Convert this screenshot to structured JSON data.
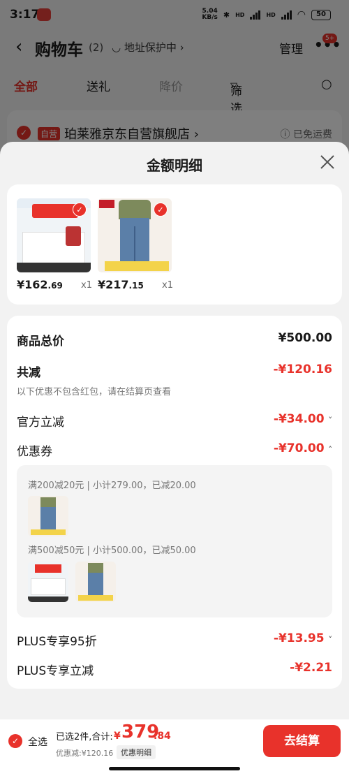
{
  "status": {
    "time": "3:17",
    "net_speed": "5.04",
    "net_unit": "KB/s",
    "sig1_label": "HD",
    "sig2_label": "HD",
    "battery": "50"
  },
  "nav": {
    "title": "购物车",
    "count": "(2)",
    "address": "地址保护中",
    "manage": "管理",
    "badge": "5+"
  },
  "tabs": [
    {
      "label": "全部"
    },
    {
      "label": "送礼"
    },
    {
      "label": "降价"
    },
    {
      "label": "筛选"
    }
  ],
  "shop": {
    "tag": "自营",
    "name": "珀莱雅京东自营旗舰店",
    "freeship": "已免运费"
  },
  "sheet": {
    "title": "金额明细",
    "products": [
      {
        "price_int": "¥162",
        "price_dec": ".69",
        "qty": "x1"
      },
      {
        "price_int": "¥217",
        "price_dec": ".15",
        "qty": "x1"
      }
    ],
    "total_label": "商品总价",
    "total_value": "¥500.00",
    "discount_label": "共减",
    "discount_value": "-¥120.16",
    "discount_note": "以下优惠不包含红包，请在结算页查看",
    "official_label": "官方立减",
    "official_value": "-¥34.00",
    "coupon_label": "优惠券",
    "coupon_value": "-¥70.00",
    "coupon_lines": [
      {
        "text": "满200减20元 | 小计279.00，已减20.00"
      },
      {
        "text": "满500减50元 | 小计500.00，已减50.00"
      }
    ],
    "plus95_label": "PLUS专享95折",
    "plus95_value": "-¥13.95",
    "plus_cut_label": "PLUS专享立减",
    "plus_cut_value": "-¥2.21"
  },
  "bottom": {
    "select_all": "全选",
    "selected_info": "已选2件,合计:",
    "total_sym": "¥",
    "total_int": "379",
    "total_dec": ".84",
    "discount_info": "优惠减:¥120.16",
    "detail_btn": "优惠明细",
    "checkout": "去结算"
  },
  "colors": {
    "accent": "#e8322b"
  }
}
